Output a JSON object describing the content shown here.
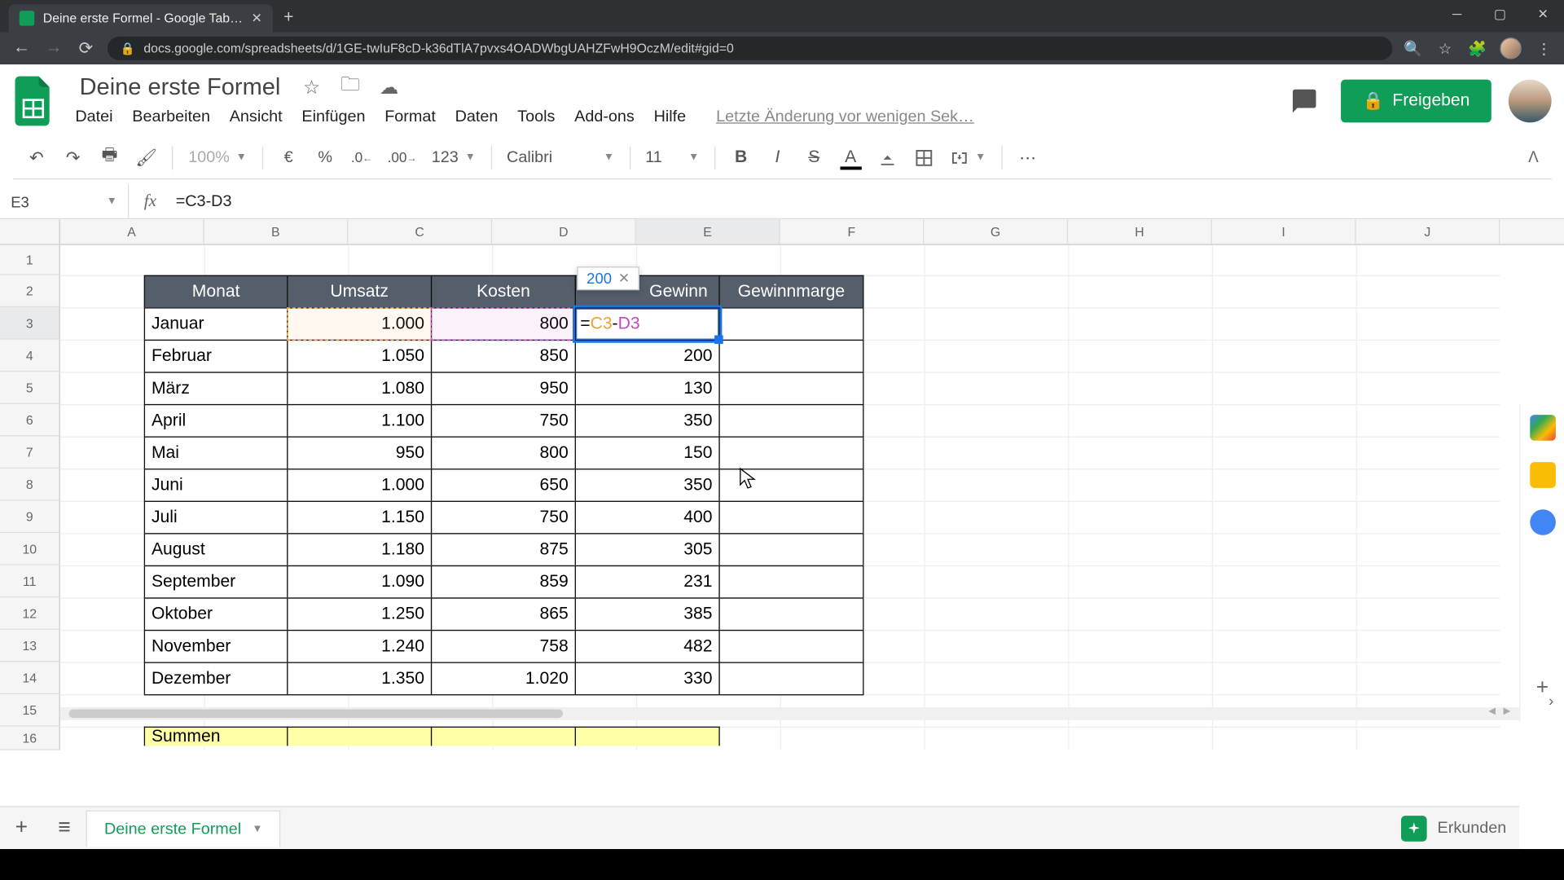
{
  "browser": {
    "tab_title": "Deine erste Formel - Google Tab…",
    "url": "docs.google.com/spreadsheets/d/1GE-twIuF8cD-k36dTlA7pvxs4OADWbgUAHZFwH9OczM/edit#gid=0"
  },
  "doc": {
    "title": "Deine erste Formel",
    "last_edit": "Letzte Änderung vor wenigen Sek…",
    "share_label": "Freigeben"
  },
  "menu": {
    "file": "Datei",
    "edit": "Bearbeiten",
    "view": "Ansicht",
    "insert": "Einfügen",
    "format": "Format",
    "data": "Daten",
    "tools": "Tools",
    "addons": "Add-ons",
    "help": "Hilfe"
  },
  "toolbar": {
    "zoom": "100%",
    "currency": "€",
    "percent": "%",
    "dec_less": ".0",
    "dec_more": ".00",
    "numfmt": "123",
    "font": "Calibri",
    "fontsize": "11"
  },
  "formula_bar": {
    "cell_ref": "E3",
    "formula": "=C3-D3"
  },
  "columns": [
    "A",
    "B",
    "C",
    "D",
    "E",
    "F",
    "G",
    "H",
    "I",
    "J"
  ],
  "rows": [
    "1",
    "2",
    "3",
    "4",
    "5",
    "6",
    "7",
    "8",
    "9",
    "10",
    "11",
    "12",
    "13",
    "14",
    "15",
    "16"
  ],
  "table": {
    "headers": {
      "monat": "Monat",
      "umsatz": "Umsatz",
      "kosten": "Kosten",
      "gewinn": "Gewinn",
      "marge": "Gewinnmarge"
    },
    "rows": [
      {
        "monat": "Januar",
        "umsatz": "1.000",
        "kosten": "800",
        "gewinn_formula_display": "=C3-D3",
        "gewinn": ""
      },
      {
        "monat": "Februar",
        "umsatz": "1.050",
        "kosten": "850",
        "gewinn": "200"
      },
      {
        "monat": "März",
        "umsatz": "1.080",
        "kosten": "950",
        "gewinn": "130"
      },
      {
        "monat": "April",
        "umsatz": "1.100",
        "kosten": "750",
        "gewinn": "350"
      },
      {
        "monat": "Mai",
        "umsatz": "950",
        "kosten": "800",
        "gewinn": "150"
      },
      {
        "monat": "Juni",
        "umsatz": "1.000",
        "kosten": "650",
        "gewinn": "350"
      },
      {
        "monat": "Juli",
        "umsatz": "1.150",
        "kosten": "750",
        "gewinn": "400"
      },
      {
        "monat": "August",
        "umsatz": "1.180",
        "kosten": "875",
        "gewinn": "305"
      },
      {
        "monat": "September",
        "umsatz": "1.090",
        "kosten": "859",
        "gewinn": "231"
      },
      {
        "monat": "Oktober",
        "umsatz": "1.250",
        "kosten": "865",
        "gewinn": "385"
      },
      {
        "monat": "November",
        "umsatz": "1.240",
        "kosten": "758",
        "gewinn": "482"
      },
      {
        "monat": "Dezember",
        "umsatz": "1.350",
        "kosten": "1.020",
        "gewinn": "330"
      }
    ],
    "summen_label": "Summen"
  },
  "edit_preview": {
    "value": "200"
  },
  "sheet_tabs": {
    "name": "Deine erste Formel",
    "explore": "Erkunden"
  }
}
